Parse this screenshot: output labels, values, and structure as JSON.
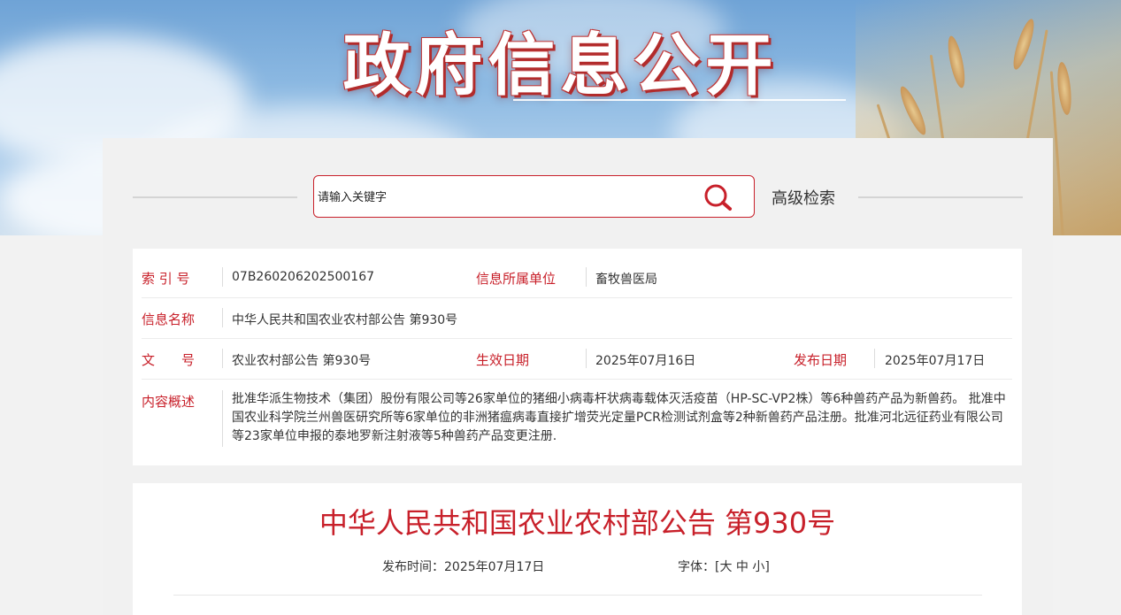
{
  "banner": {
    "title": "政府信息公开"
  },
  "search": {
    "placeholder": "请输入关键字",
    "advanced_label": "高级检索"
  },
  "info": {
    "index_label": "索 引 号",
    "index_value": "07B260206202500167",
    "unit_label": "信息所属单位",
    "unit_value": "畜牧兽医局",
    "name_label": "信息名称",
    "name_value": "中华人民共和国农业农村部公告 第930号",
    "doc_label": "文　　号",
    "doc_value": "农业农村部公告 第930号",
    "effective_label": "生效日期",
    "effective_value": "2025年07月16日",
    "publish_label": "发布日期",
    "publish_value": "2025年07月17日",
    "summary_label": "内容概述",
    "summary_value": "批准华派生物技术（集团）股份有限公司等26家单位的猪细小病毒杆状病毒载体灭活疫苗（HP-SC-VP2株）等6种兽药产品为新兽药。 批准中国农业科学院兰州兽医研究所等6家单位的非洲猪瘟病毒直接扩增荧光定量PCR检测试剂盒等2种新兽药产品注册。批准河北远征药业有限公司等23家单位申报的泰地罗新注射液等5种兽药产品变更注册."
  },
  "article": {
    "title": "中华人民共和国农业农村部公告 第930号",
    "publish_time_label": "发布时间：",
    "publish_time_value": "2025年07月17日",
    "font_label": "字体：",
    "font_open": "[",
    "font_large": "大",
    "font_medium": "中",
    "font_small": "小",
    "font_close": "]"
  },
  "colors": {
    "accent": "#c8202a",
    "text": "#333333",
    "panel_bg": "#f1f1f1"
  }
}
